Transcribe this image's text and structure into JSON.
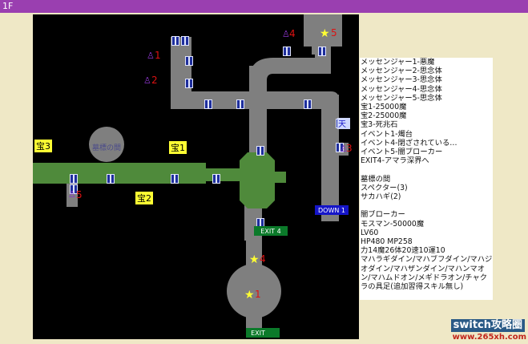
{
  "floor_label": "1F",
  "map": {
    "room_name": "墓標の間",
    "exits": [
      "DOWN 1",
      "EXIT 4",
      "EXIT"
    ],
    "treasures": [
      "宝1",
      "宝2",
      "宝3"
    ],
    "star_markers": [
      "1",
      "4",
      "5"
    ],
    "messenger_markers": [
      "1",
      "2",
      "4",
      "5"
    ],
    "purple_markers": [
      "3"
    ],
    "event_marker": "5",
    "blue_marker": "天"
  },
  "legend": {
    "lines": [
      "メッセンジャー1-悪魔",
      "メッセンジャー2-思念体",
      "メッセンジャー3-思念体",
      "メッセンジャー4-思念体",
      "メッセンジャー5-思念体",
      "宝1-25000魔",
      "宝2-25000魔",
      "宝3-死兆石",
      "イベント1-燭台",
      "イベント4-閉ざされている…",
      "イベント5-闇ブローカー",
      "EXIT4-アマラ深界へ",
      "",
      "墓標の間",
      "スペクター(3)",
      "サカハギ(2)",
      "",
      "闇ブローカー",
      "モスマン-50000魔",
      "LV60",
      "HP480 MP258",
      "力14魔26体20速10運10",
      "マハラギダイン/マハブフダイン/マハジオダイン/マハザンダイン/マハンマオン/マハムドオン/メギドラオン/チャクラの具足(追加習得スキル無し)"
    ]
  },
  "watermark": {
    "brand": "switch攻略圈",
    "url": "www.265xh.com"
  },
  "colors": {
    "title_bar": "#9a3fb0",
    "background": "#efe8c6",
    "map_background": "#000000",
    "corridor": "#7f7f7f",
    "green_area": "#4f8a3b",
    "door": "#1e2e9c",
    "exit_label": "#0b7a2a",
    "down_label": "#1515c8",
    "treasure_label": "#ffff33",
    "star": "#ffff33",
    "marker_red": "#dd1111",
    "marker_purple": "#8a35c8"
  }
}
